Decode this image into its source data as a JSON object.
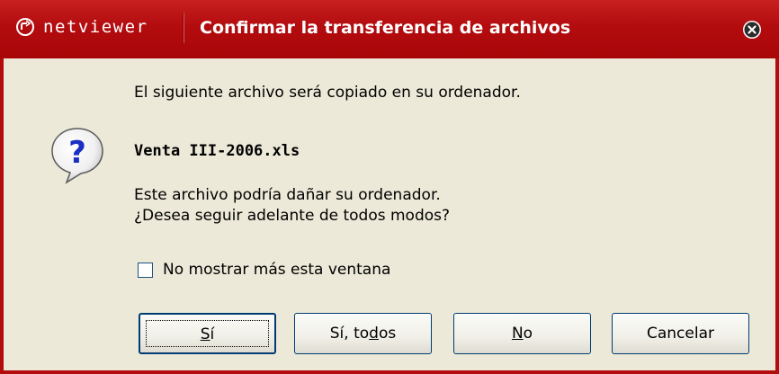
{
  "titlebar": {
    "brand": "netviewer",
    "title": "Confirmar la transferencia de archivos",
    "close_icon": "close-icon"
  },
  "dialog": {
    "message": "El siguiente archivo será copiado en su ordenador.",
    "filename": "Venta III-2006.xls",
    "warning_line1": "Este archivo podría dañar su ordenador.",
    "warning_line2": "¿Desea seguir adelante de todos modos?",
    "icon": "question-icon",
    "checkbox_label": "No mostrar más esta ventana",
    "checkbox_checked": false
  },
  "buttons": {
    "yes": {
      "before": "",
      "mnemonic": "S",
      "after": "í"
    },
    "yes_all": {
      "before": "Sí, to",
      "mnemonic": "d",
      "after": "os"
    },
    "no": {
      "before": "",
      "mnemonic": "N",
      "after": "o"
    },
    "cancel": "Cancelar"
  },
  "colors": {
    "titlebar": "#b30c0f",
    "body": "#ece9d8",
    "button_border": "#003c74"
  }
}
